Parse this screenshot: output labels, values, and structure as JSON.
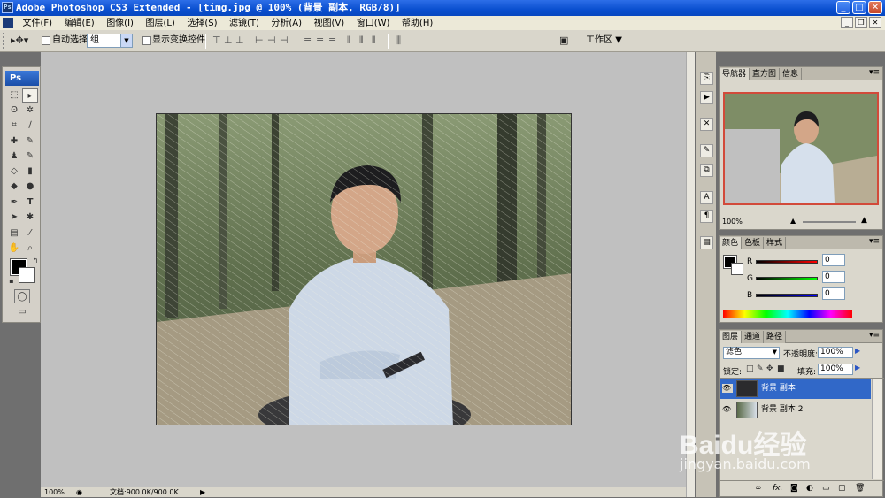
{
  "window": {
    "title": "Adobe Photoshop CS3 Extended - [timg.jpg @ 100% (背景 副本, RGB/8)]",
    "app_icon": "Ps"
  },
  "menu": [
    "文件(F)",
    "编辑(E)",
    "图像(I)",
    "图层(L)",
    "选择(S)",
    "滤镜(T)",
    "分析(A)",
    "视图(V)",
    "窗口(W)",
    "帮助(H)"
  ],
  "options_bar": {
    "auto_select_label": "自动选择:",
    "auto_select_value": "组",
    "show_transform_label": "显示变换控件",
    "workspace_label": "工作区"
  },
  "toolbox": {
    "logo": "Ps"
  },
  "status": {
    "zoom": "100%",
    "doc_info": "文档:900.0K/900.0K"
  },
  "navigator": {
    "tabs": [
      "导航器",
      "直方图",
      "信息"
    ],
    "zoom": "100%"
  },
  "color_panel": {
    "tabs": [
      "颜色",
      "色板",
      "样式"
    ],
    "channels": [
      {
        "label": "R",
        "value": "0"
      },
      {
        "label": "G",
        "value": "0"
      },
      {
        "label": "B",
        "value": "0"
      }
    ]
  },
  "layers_panel": {
    "tabs": [
      "图层",
      "通道",
      "路径"
    ],
    "blend_mode": "滤色",
    "opacity_label": "不透明度:",
    "opacity_value": "100%",
    "lock_label": "锁定:",
    "fill_label": "填充:",
    "fill_value": "100%",
    "layers": [
      {
        "name": "背景 副本",
        "selected": true
      },
      {
        "name": "背景 副本 2",
        "selected": false
      }
    ]
  },
  "watermark": {
    "brand": "Baidu经验",
    "url": "jingyan.baidu.com"
  }
}
